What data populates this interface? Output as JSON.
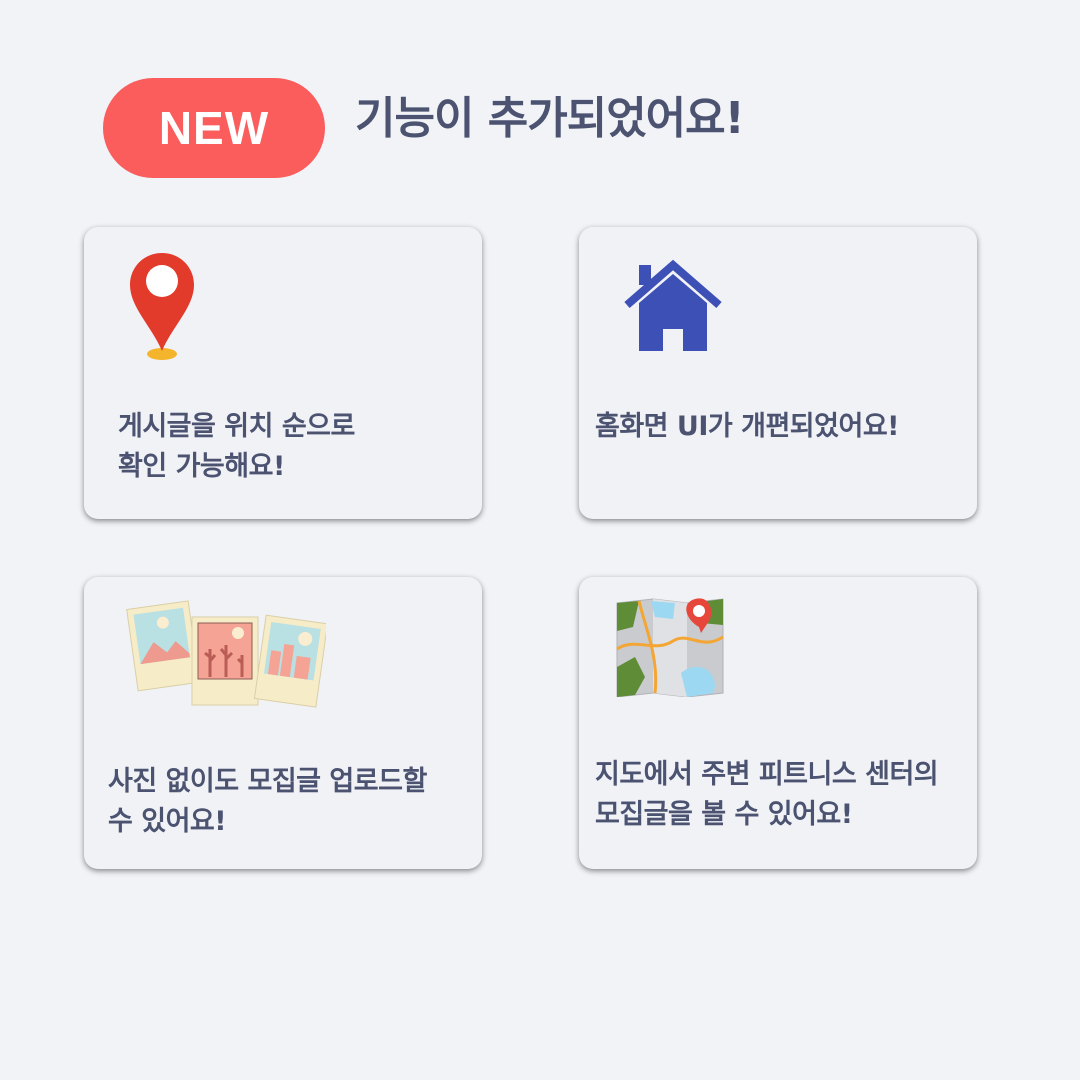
{
  "header": {
    "badge": "NEW",
    "title": "기능이 추가되었어요!"
  },
  "cards": [
    {
      "icon": "location-pin-icon",
      "lines": [
        "게시글을 위치 순으로",
        "확인 가능해요!"
      ]
    },
    {
      "icon": "home-icon",
      "lines": [
        "홈화면 UI가 개편되었어요!"
      ]
    },
    {
      "icon": "photos-icon",
      "lines": [
        "사진 없이도 모집글 업로드할",
        "수 있어요!"
      ]
    },
    {
      "icon": "map-icon",
      "lines": [
        "지도에서 주변 피트니스 센터의",
        "모집글을 볼 수 있어요!"
      ]
    }
  ],
  "colors": {
    "background": "#f1f3f7",
    "badge": "#fa5d5c",
    "text": "#4b5371",
    "home_icon": "#3d50b5",
    "pin": "#e23a2b"
  }
}
